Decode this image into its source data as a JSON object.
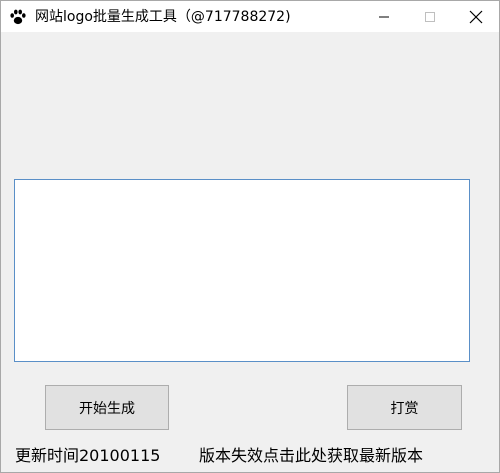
{
  "window": {
    "title": "网站logo批量生成工具（@717788272)",
    "icon": "paw-icon"
  },
  "titlebar_buttons": {
    "minimize_icon": "minimize-icon",
    "maximize_icon": "maximize-icon",
    "close_icon": "close-icon"
  },
  "main": {
    "text_area_value": ""
  },
  "buttons": {
    "start_label": "开始生成",
    "donate_label": "打赏"
  },
  "footer": {
    "update_time": "更新时间20100115",
    "version_link": "版本失效点击此处获取最新版本"
  }
}
